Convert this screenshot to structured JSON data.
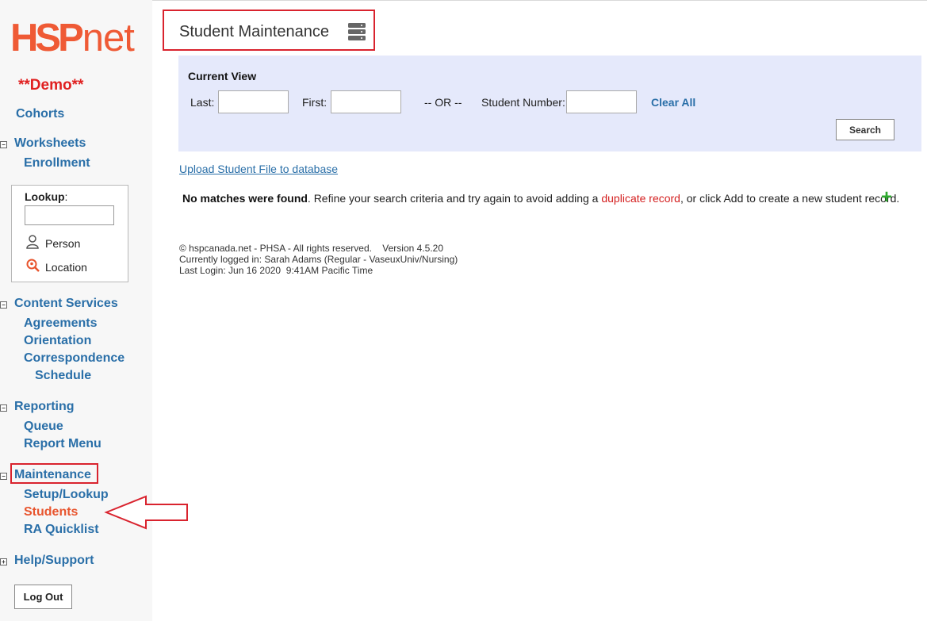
{
  "logo": {
    "caps": "HSP",
    "low": "net"
  },
  "demo": "**Demo**",
  "nav": {
    "cohorts": "Cohorts",
    "worksheets": "Worksheets",
    "enrollment": "Enrollment",
    "content_services": "Content Services",
    "agreements": "Agreements",
    "orientation": "Orientation",
    "correspondence": "Correspondence",
    "schedule": "Schedule",
    "reporting": "Reporting",
    "queue": "Queue",
    "report_menu": "Report Menu",
    "maintenance": "Maintenance",
    "setup_lookup": "Setup/Lookup",
    "students": "Students",
    "ra_quicklist": "RA Quicklist",
    "help_support": "Help/Support"
  },
  "toggles": {
    "collapse": "−",
    "expand": "+"
  },
  "lookup": {
    "label": "Lookup",
    "colon": ":",
    "input_value": "",
    "person": "Person",
    "location": "Location"
  },
  "logout": "Log Out",
  "page": {
    "title": "Student Maintenance"
  },
  "search": {
    "current_view": "Current View",
    "last_label": "Last:",
    "first_label": "First:",
    "or": "-- OR --",
    "student_number_label": "Student Number:",
    "last_value": "",
    "first_value": "",
    "student_number_value": "",
    "clear_all": "Clear All",
    "search_button": "Search"
  },
  "upload_link": "Upload Student File to database",
  "message": {
    "bold": "No matches were found",
    "part1": ". Refine your search criteria and try again to avoid adding a ",
    "link": "duplicate record",
    "part2": ", or click Add to create a new student record."
  },
  "add_icon": "+",
  "footer": {
    "line1": "© hspcanada.net - PHSA - All rights reserved.    Version 4.5.20",
    "line2": "Currently logged in: Sarah Adams (Regular - VaseuxUniv/Nursing)",
    "line3": "Last Login: Jun 16 2020  9:41AM Pacific Time"
  },
  "colors": {
    "brand": "#ef5a35",
    "link": "#2a6fa8",
    "highlight": "#d9232e",
    "panel": "#e5e9fb",
    "add": "#2eaa2e"
  }
}
